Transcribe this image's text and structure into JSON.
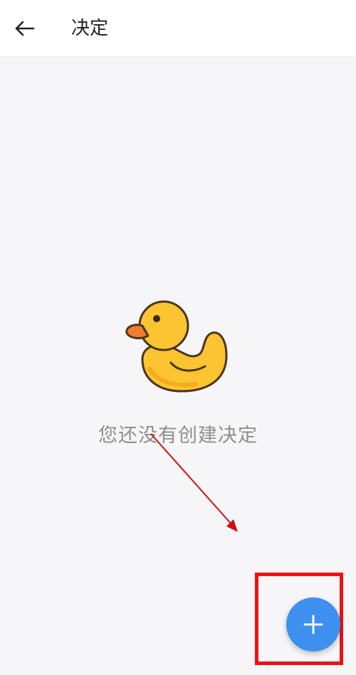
{
  "header": {
    "title": "决定",
    "back_icon": "arrow-left-icon"
  },
  "empty_state": {
    "illustration": "rubber-duck-icon",
    "message": "您还没有创建决定"
  },
  "fab": {
    "icon": "plus-icon",
    "color": "#3d8ff0"
  },
  "annotations": {
    "highlight_color": "#ee1111",
    "arrow_color": "#cc1111"
  }
}
